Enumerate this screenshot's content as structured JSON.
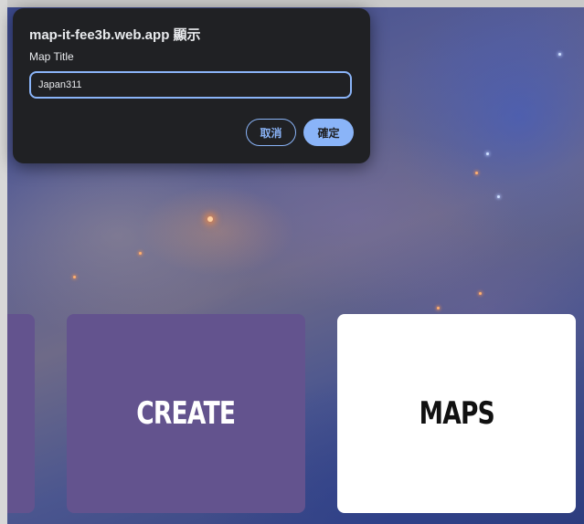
{
  "dialog": {
    "title": "map-it-fee3b.web.app 顯示",
    "message": "Map Title",
    "input_value": "Japan311",
    "cancel_label": "取消",
    "ok_label": "確定"
  },
  "tiles": {
    "create_label": "CREATE",
    "maps_label": "MAPS"
  },
  "colors": {
    "tile_purple": "#63538e",
    "tile_white": "#ffffff",
    "dialog_bg": "#202124",
    "accent": "#8ab4f8"
  }
}
